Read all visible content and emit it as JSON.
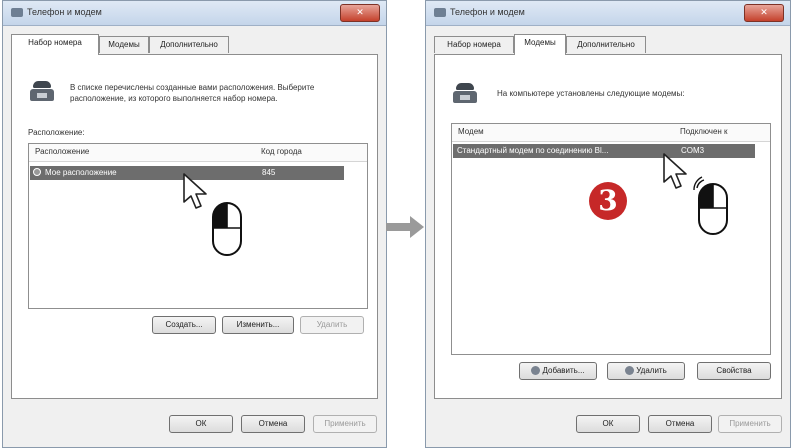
{
  "left": {
    "title": "Телефон и модем",
    "tabs": [
      "Набор номера",
      "Модемы",
      "Дополнительно"
    ],
    "description": "В списке перечислены созданные вами расположения. Выберите расположение, из которого выполняется набор номера.",
    "group_label": "Расположение:",
    "columns": [
      "Расположение",
      "Код города"
    ],
    "row": {
      "location": "Мое расположение",
      "code": "845"
    },
    "buttons": {
      "create": "Создать...",
      "edit": "Изменить...",
      "delete": "Удалить"
    },
    "footer": {
      "ok": "ОК",
      "cancel": "Отмена",
      "apply": "Применить"
    }
  },
  "right": {
    "title": "Телефон и модем",
    "tabs": [
      "Набор номера",
      "Модемы",
      "Дополнительно"
    ],
    "description": "На компьютере установлены следующие модемы:",
    "columns": [
      "Модем",
      "Подключен к"
    ],
    "row": {
      "modem": "Стандартный модем по соединению Bl...",
      "port": "COM3"
    },
    "buttons": {
      "add": "Добавить...",
      "remove": "Удалить",
      "properties": "Свойства"
    },
    "footer": {
      "ok": "ОК",
      "cancel": "Отмена",
      "apply": "Применить"
    }
  },
  "step_number": "3",
  "icons": {
    "window": "phone-modem-icon",
    "phone": "phone-icon",
    "cursor": "pointer-cursor-icon",
    "mouse": "mouse-left-click-icon",
    "flow": "arrow-right-icon"
  },
  "colors": {
    "selection": "#6d6d6d",
    "step_badge": "#c62828",
    "close_button": "#c4412c"
  }
}
